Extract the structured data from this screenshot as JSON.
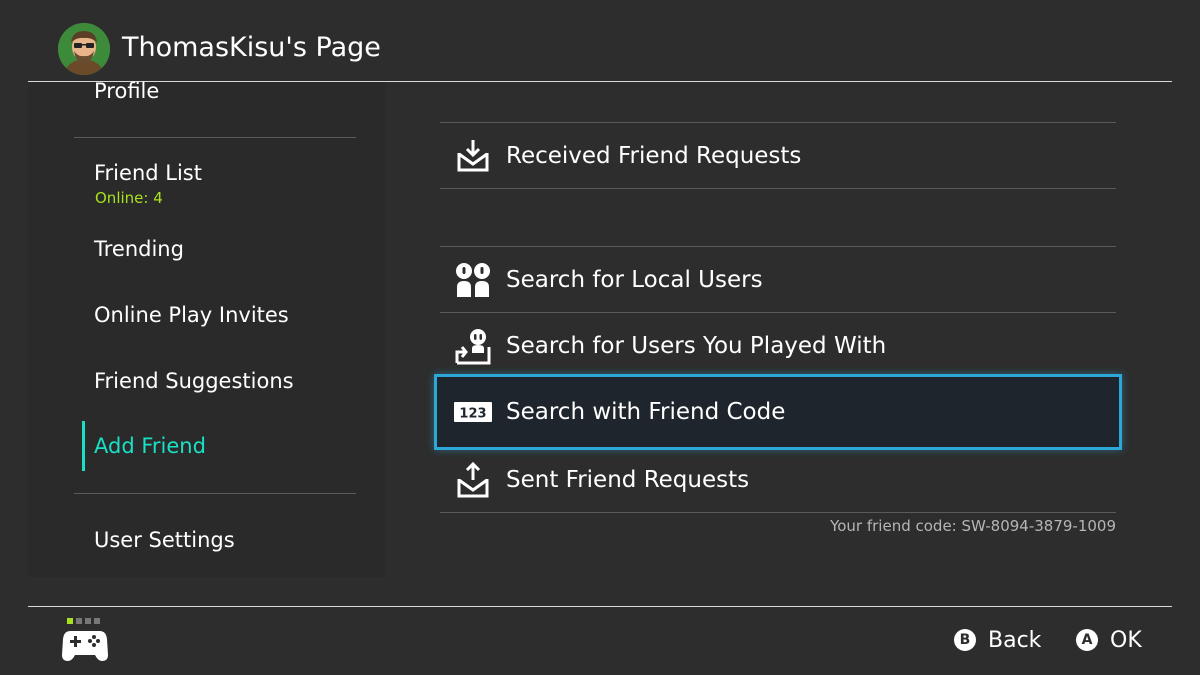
{
  "header": {
    "title": "ThomasKisu's Page",
    "avatar": "user-avatar"
  },
  "sidebar": {
    "items": [
      {
        "label": "Profile"
      },
      {
        "label": "Friend List",
        "sub": "Online: 4"
      },
      {
        "label": "Trending"
      },
      {
        "label": "Online Play Invites"
      },
      {
        "label": "Friend Suggestions"
      },
      {
        "label": "Add Friend",
        "active": true
      },
      {
        "label": "User Settings"
      }
    ]
  },
  "menu": {
    "items": [
      {
        "label": "Received Friend Requests",
        "icon": "inbox-download-icon"
      },
      {
        "label": "Search for Local Users",
        "icon": "local-users-icon"
      },
      {
        "label": "Search for Users You Played With",
        "icon": "played-with-icon"
      },
      {
        "label": "Search with Friend Code",
        "icon": "number-code-icon",
        "selected": true,
        "icon_text": "123"
      },
      {
        "label": "Sent Friend Requests",
        "icon": "outbox-upload-icon"
      }
    ],
    "friend_code": "Your friend code: SW-8094-3879-1009"
  },
  "footer": {
    "back": {
      "button": "B",
      "label": "Back"
    },
    "ok": {
      "button": "A",
      "label": "OK"
    },
    "controller_icon": "controller-icon"
  },
  "colors": {
    "background": "#2d2d2d",
    "accent_teal": "#19e0c5",
    "online_green": "#a8e21d",
    "selection_blue": "#2da7d8"
  }
}
